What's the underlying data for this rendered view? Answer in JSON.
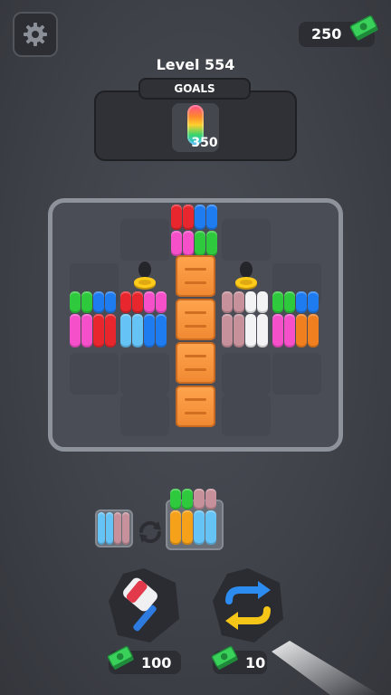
{
  "header": {
    "currency_amount": "250",
    "level_title": "Level 554"
  },
  "goals": {
    "label": "GOALS",
    "count": "350"
  },
  "powerups": [
    {
      "name": "hammer",
      "price": "100"
    },
    {
      "name": "swap",
      "price": "10"
    }
  ],
  "icons": [
    "gear-icon",
    "cash-icon",
    "hammer-icon",
    "swap-icon",
    "refresh-icon"
  ],
  "colors": {
    "red": "#e8262d",
    "blue": "#1f7cf0",
    "pink": "#f54fc9",
    "green": "#2fc93e",
    "lightblue": "#66c3f5",
    "mauve": "#c7919b",
    "white": "#f3f3f5",
    "orange": "#f07f1f"
  }
}
